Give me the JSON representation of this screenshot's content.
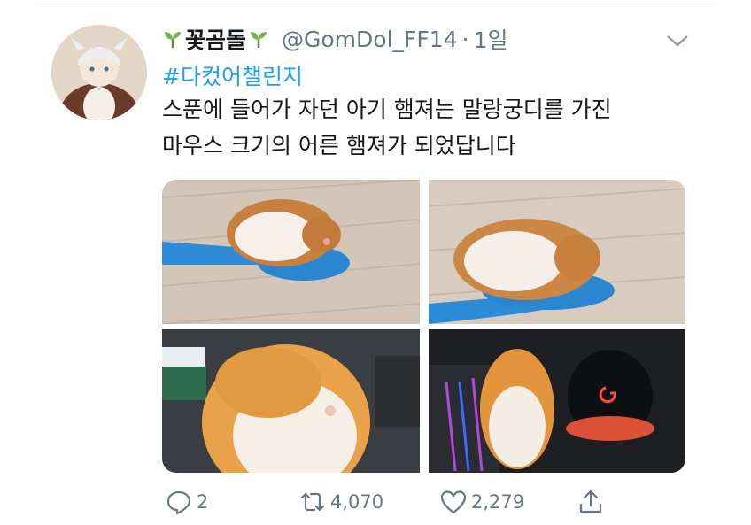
{
  "tweet": {
    "display_name": "꽃곰돌",
    "handle": "@GomDol_FF14",
    "separator": "·",
    "time": "1일",
    "hashtag": "#다컸어챌린지",
    "text_lines": [
      "스푼에 들어가 자던 아기 햄져는 말랑궁디를 가진",
      "마우스 크기의 어른 햄져가 되었답니다"
    ]
  },
  "media": [
    {
      "icon": "hamster-on-spoon-photo"
    },
    {
      "icon": "hamster-on-spoon-closeup-photo"
    },
    {
      "icon": "adult-hamster-back-photo"
    },
    {
      "icon": "hamster-beside-mouse-photo"
    }
  ],
  "actions": {
    "reply_count": "2",
    "retweet_count": "4,070",
    "like_count": "2,279"
  },
  "colors": {
    "link": "#1da1f2",
    "secondary_text": "#657786",
    "primary_text": "#14171a",
    "divider": "#e6ecf0"
  }
}
